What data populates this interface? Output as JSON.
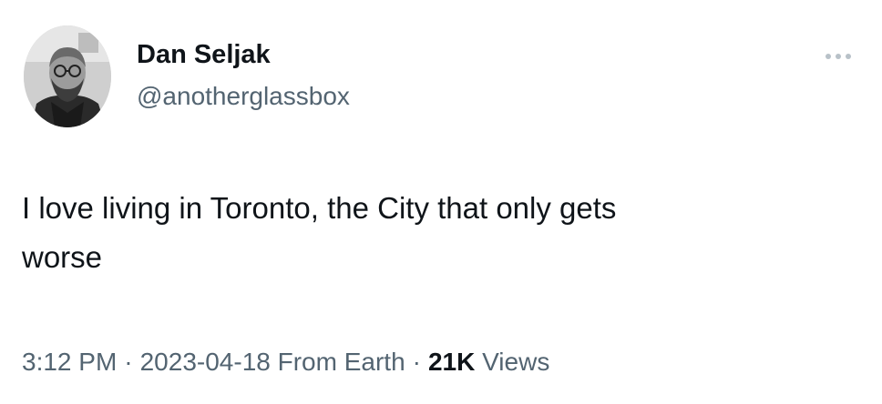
{
  "tweet": {
    "author": {
      "display_name": "Dan Seljak",
      "handle": "@anotherglassbox",
      "avatar_icon": "profile-photo"
    },
    "more_icon": "more-horizontal-icon",
    "text": "I love living in Toronto, the City that only gets\nworse",
    "meta": {
      "time": "3:12 PM",
      "separator": "·",
      "date": "2023-04-18",
      "source": "From Earth",
      "views_count": "21K",
      "views_label": "Views"
    }
  },
  "colors": {
    "primary_text": "#0f1419",
    "secondary_text": "#536471",
    "background": "#ffffff"
  }
}
